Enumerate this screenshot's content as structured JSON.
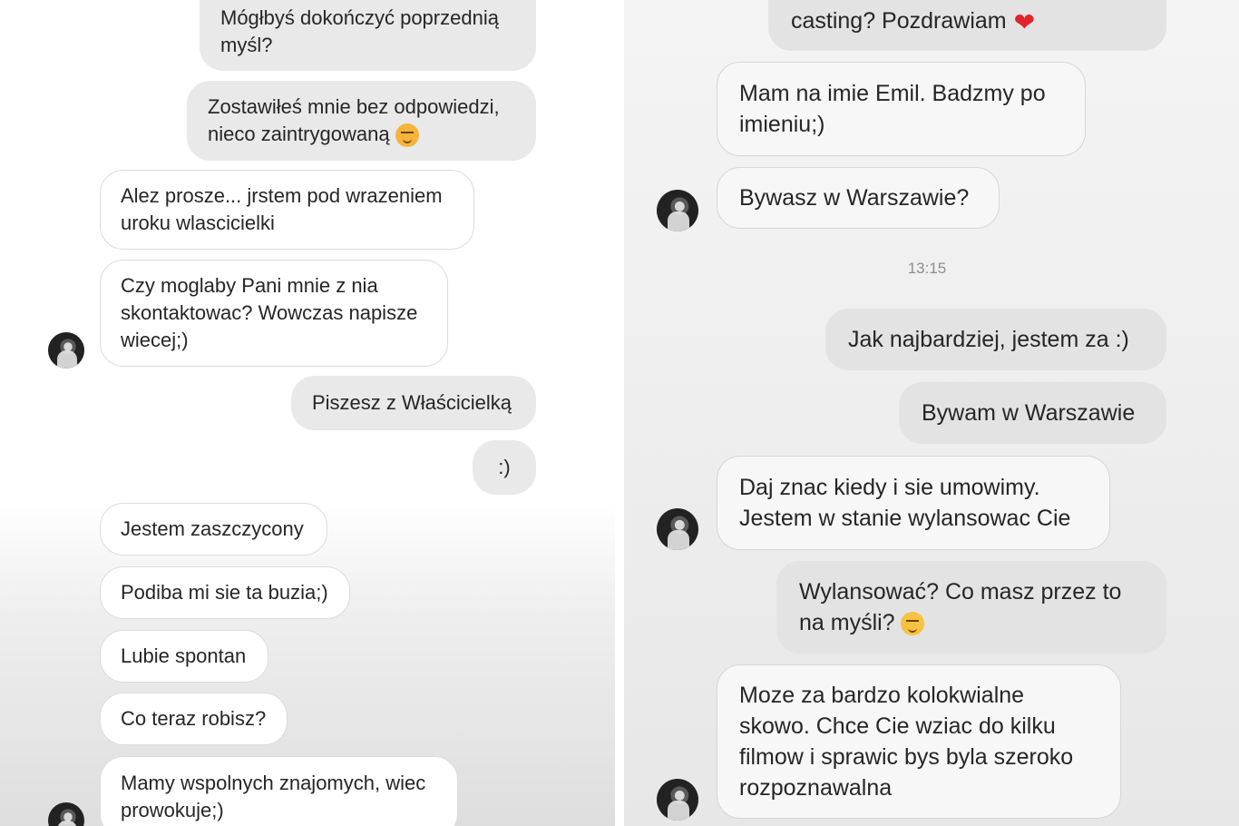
{
  "left_chat": {
    "messages": [
      {
        "text": "Mógłbyś dokończyć poprzednią\nmyśl?",
        "emoji": ""
      },
      {
        "text": "Zostawiłeś mnie bez odpowiedzi,\nnieco zaintrygowaną",
        "emoji": "flushed-face-emoji"
      },
      {
        "text": "Alez prosze... jrstem pod wrazeniem\nuroku wlascicielki",
        "emoji": ""
      },
      {
        "text": "Czy moglaby Pani mnie z nia\nskontaktowac? Wowczas napisze\nwiecej;)",
        "emoji": ""
      },
      {
        "text": "Piszesz z Właścicielką",
        "emoji": ""
      },
      {
        "text": ":)",
        "emoji": ""
      },
      {
        "text": "Jestem zaszczycony",
        "emoji": ""
      },
      {
        "text": "Podiba mi sie ta buzia;)",
        "emoji": ""
      },
      {
        "text": "Lubie spontan",
        "emoji": ""
      },
      {
        "text": "Co teraz robisz?",
        "emoji": ""
      },
      {
        "text": "Mamy wspolnych znajomych, wiec\nprowokuje;)",
        "emoji": ""
      }
    ]
  },
  "right_chat": {
    "messages": [
      {
        "text": "casting? Pozdrawiam",
        "emoji": "red-heart-emoji"
      },
      {
        "text": "Mam na imie Emil. Badzmy po\nimieniu;)",
        "emoji": ""
      },
      {
        "text": "Bywasz w Warszawie?",
        "emoji": ""
      },
      {
        "text": "Jak najbardziej, jestem za :)",
        "emoji": ""
      },
      {
        "text": "Bywam w Warszawie",
        "emoji": ""
      },
      {
        "text": "Daj znac kiedy i sie umowimy.\nJestem w stanie wylansowac Cie",
        "emoji": ""
      },
      {
        "text": "Wylansować? Co masz przez to\nna myśli?",
        "emoji": "smiling-face-emoji"
      },
      {
        "text": "Moze za bardzo kolokwialne\nskowo. Chce Cie wziac do kilku\nfilmow i sprawic bys byla szeroko\nrozpoznawalna",
        "emoji": ""
      }
    ],
    "timestamp": "13:15"
  },
  "colors": {
    "incoming_bubble": "#ffffff",
    "outgoing_bubble": "#e9e9e9",
    "text": "#262626",
    "timestamp": "#8e8e8e",
    "heart": "#e0242c"
  }
}
